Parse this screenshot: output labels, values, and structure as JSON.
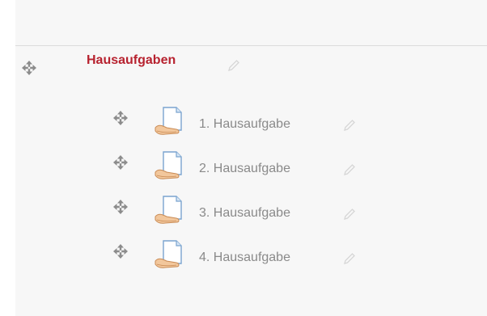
{
  "section": {
    "title": "Hausaufgaben"
  },
  "activities": [
    {
      "label": "1. Hausaufgabe"
    },
    {
      "label": "2. Hausaufgabe"
    },
    {
      "label": "3. Hausaufgabe"
    },
    {
      "label": "4. Hausaufgabe"
    }
  ],
  "colors": {
    "section_title": "#b7222f",
    "activity_label": "#8a8a8a",
    "panel_bg": "#f7f7f7",
    "divider": "#dcdcdc"
  },
  "icons": {
    "move": "move-icon",
    "edit": "pencil-icon",
    "activity": "assignment-icon"
  }
}
